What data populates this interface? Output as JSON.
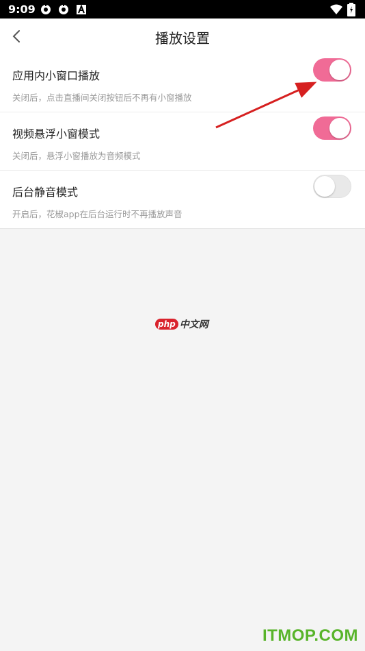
{
  "status_bar": {
    "time": "9:09",
    "left_icons": [
      "settings-gear-icon",
      "settings-gear-icon",
      "text-a-icon"
    ],
    "right_icons": [
      "wifi-icon",
      "battery-icon"
    ]
  },
  "header": {
    "back_icon": "chevron-left-icon",
    "title": "播放设置"
  },
  "settings": {
    "items": [
      {
        "title": "应用内小窗口播放",
        "desc": "关闭后，点击直播间关闭按钮后不再有小窗播放",
        "enabled": true
      },
      {
        "title": "视频悬浮小窗模式",
        "desc": "关闭后，悬浮小窗播放为音频模式",
        "enabled": true
      },
      {
        "title": "后台静音模式",
        "desc": "开启后，花椒app在后台运行时不再播放声音",
        "enabled": false
      }
    ]
  },
  "colors": {
    "toggle_on": "#f06b96",
    "toggle_off": "#e9e9e9",
    "annotation_arrow": "#d62020"
  },
  "branding": {
    "php_badge": "php",
    "php_cn": "中文网",
    "watermark": "ITMOP.COM"
  }
}
